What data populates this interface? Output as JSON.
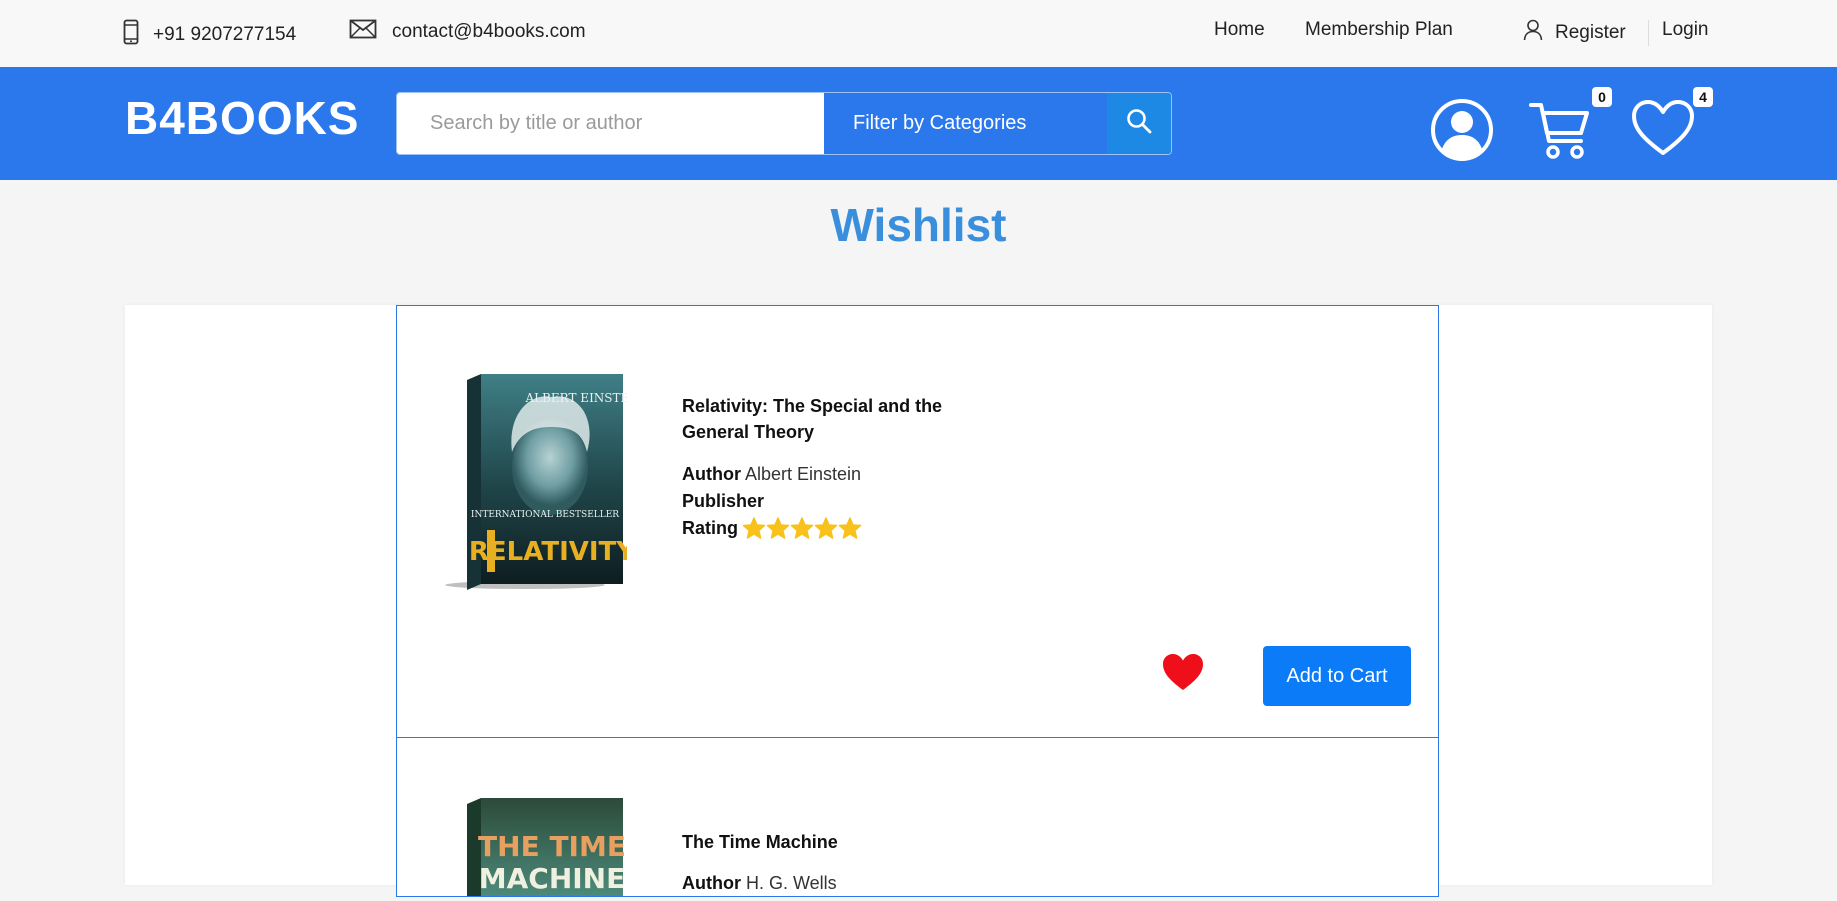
{
  "topbar": {
    "phone": "+91 9207277154",
    "email": "contact@b4books.com",
    "nav": {
      "home": "Home",
      "membership": "Membership Plan",
      "register": "Register",
      "login": "Login"
    }
  },
  "header": {
    "logo": "B4BOOKS",
    "search_placeholder": "Search by title or author",
    "filter_label": "Filter by Categories",
    "cart_count": "0",
    "wishlist_count": "4",
    "brand_color": "#2b78ec"
  },
  "page": {
    "title": "Wishlist"
  },
  "wishlist": [
    {
      "title": "Relativity: The Special and the General Theory",
      "author_label": "Author",
      "author": "Albert Einstein",
      "publisher_label": "Publisher",
      "publisher": "",
      "rating_label": "Rating",
      "rating": 5,
      "add_to_cart": "Add to Cart",
      "cover_text": "RELATIVITY",
      "cover_author": "ALBERT EINSTEIN",
      "cover_tag": "INTERNATIONAL BESTSELLER"
    },
    {
      "title": "The Time Machine",
      "author_label": "Author",
      "author": "H. G. Wells",
      "cover_text": "THE TIME MACHINE"
    }
  ]
}
